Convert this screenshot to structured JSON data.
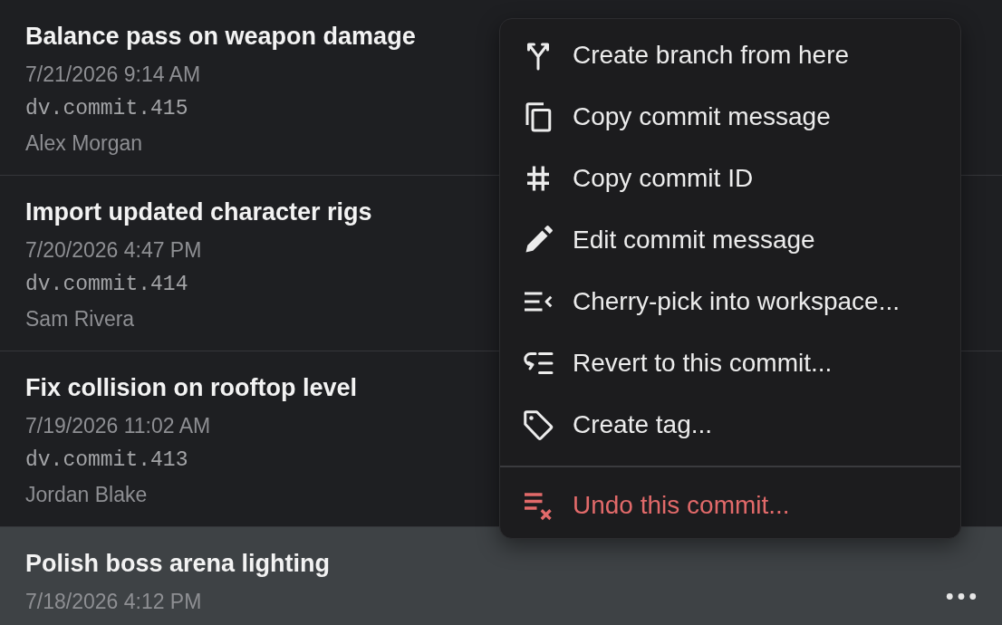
{
  "commits": [
    {
      "title": "Balance pass on weapon damage",
      "date": "7/21/2026 9:14 AM",
      "commit_id": "dv.commit.415",
      "author": "Alex Morgan",
      "selected": false
    },
    {
      "title": "Import updated character rigs",
      "date": "7/20/2026 4:47 PM",
      "commit_id": "dv.commit.414",
      "author": "Sam Rivera",
      "selected": false
    },
    {
      "title": "Fix collision on rooftop level",
      "date": "7/19/2026 11:02 AM",
      "commit_id": "dv.commit.413",
      "author": "Jordan Blake",
      "selected": false
    },
    {
      "title": "Polish boss arena lighting",
      "date": "7/18/2026 4:12 PM",
      "selected": true
    }
  ],
  "context_menu": {
    "groups": [
      {
        "items": [
          {
            "label": "Create branch from here",
            "kind": "action"
          },
          {
            "label": "Copy commit message",
            "kind": "action"
          },
          {
            "label": "Copy commit ID",
            "kind": "action"
          },
          {
            "label": "Edit commit message",
            "kind": "action"
          },
          {
            "label": "Cherry-pick into workspace...",
            "kind": "action"
          },
          {
            "label": "Revert to this commit...",
            "kind": "action"
          },
          {
            "label": "Create tag...",
            "kind": "action"
          }
        ]
      },
      {
        "items": [
          {
            "label": "Undo this commit...",
            "kind": "destructive"
          }
        ]
      }
    ]
  }
}
